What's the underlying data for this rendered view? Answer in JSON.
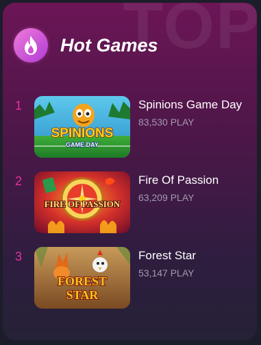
{
  "background_word": "TOP",
  "header": {
    "icon": "fire-icon",
    "title": "Hot Games"
  },
  "colors": {
    "rank": "#e62fa2",
    "title": "#ffffff",
    "plays": "#a69ab0",
    "badge": "#d14fd8"
  },
  "games": [
    {
      "rank": "1",
      "name": "Spinions Game Day",
      "plays": "83,530 PLAY",
      "logo_lines": [
        "SPINIONS",
        "GAME DAY"
      ]
    },
    {
      "rank": "2",
      "name": "Fire Of Passion",
      "plays": "63,209 PLAY",
      "logo_lines": [
        "FIRE OF PASSION"
      ]
    },
    {
      "rank": "3",
      "name": "Forest Star",
      "plays": "53,147 PLAY",
      "logo_lines": [
        "FOREST",
        "STAR"
      ]
    }
  ]
}
